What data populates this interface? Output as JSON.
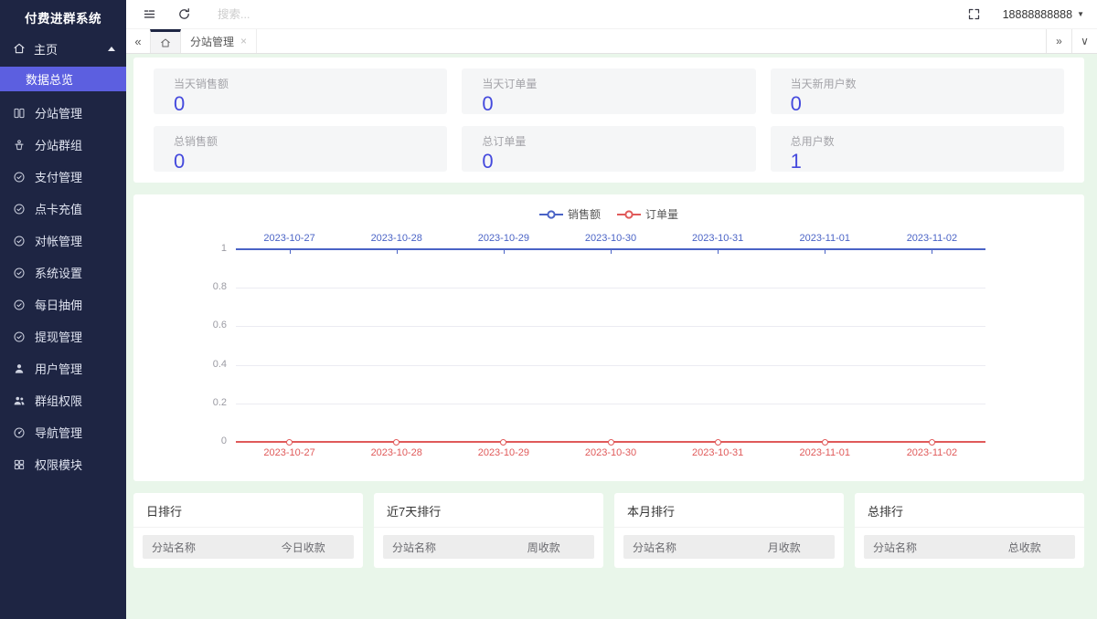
{
  "app": {
    "title": "付费进群系统"
  },
  "topbar": {
    "search_placeholder": "搜索...",
    "user_phone": "18888888888"
  },
  "glyphs": {
    "tabs_prev": "«",
    "tabs_next": "»",
    "tabs_menu": "∨",
    "tab_close": "×",
    "user_caret": "▼"
  },
  "tabbar": {
    "tabs": [
      {
        "label": "分站管理",
        "closable": true
      }
    ]
  },
  "sidebar": {
    "home": {
      "label": "主页"
    },
    "submenu_active": {
      "label": "数据总览"
    },
    "items": [
      {
        "label": "分站管理",
        "icon": "columns-icon"
      },
      {
        "label": "分站群组",
        "icon": "podium-icon"
      },
      {
        "label": "支付管理",
        "icon": "circle-check-icon"
      },
      {
        "label": "点卡充值",
        "icon": "circle-check-icon"
      },
      {
        "label": "对帐管理",
        "icon": "circle-check-icon"
      },
      {
        "label": "系统设置",
        "icon": "circle-check-icon"
      },
      {
        "label": "每日抽佣",
        "icon": "circle-check-icon"
      },
      {
        "label": "提现管理",
        "icon": "circle-check-icon"
      },
      {
        "label": "用户管理",
        "icon": "user-icon"
      },
      {
        "label": "群组权限",
        "icon": "users-icon"
      },
      {
        "label": "导航管理",
        "icon": "gauge-icon"
      },
      {
        "label": "权限模块",
        "icon": "grid-icon"
      }
    ]
  },
  "stats": {
    "items": [
      {
        "label": "当天销售额",
        "value": "0"
      },
      {
        "label": "当天订单量",
        "value": "0"
      },
      {
        "label": "当天新用户数",
        "value": "0"
      },
      {
        "label": "总销售额",
        "value": "0"
      },
      {
        "label": "总订单量",
        "value": "0"
      },
      {
        "label": "总用户数",
        "value": "1"
      }
    ]
  },
  "chart_data": {
    "type": "line",
    "title": "",
    "x": [
      "2023-10-27",
      "2023-10-28",
      "2023-10-29",
      "2023-10-30",
      "2023-10-31",
      "2023-11-01",
      "2023-11-02"
    ],
    "series": [
      {
        "name": "销售额",
        "color": "#4a63c6",
        "values": [
          0,
          0,
          0,
          0,
          0,
          0,
          0
        ],
        "x_axis": "top"
      },
      {
        "name": "订单量",
        "color": "#e05a5a",
        "values": [
          0,
          0,
          0,
          0,
          0,
          0,
          0
        ],
        "x_axis": "bottom"
      }
    ],
    "ylim": [
      0,
      1
    ],
    "y_ticks": [
      0,
      0.2,
      0.4,
      0.6,
      0.8,
      1
    ],
    "grid": "horizontal-lines",
    "legend_position": "top-center"
  },
  "rankings": [
    {
      "title": "日排行",
      "columns": [
        "分站名称",
        "今日收款"
      ],
      "rows": []
    },
    {
      "title": "近7天排行",
      "columns": [
        "分站名称",
        "周收款"
      ],
      "rows": []
    },
    {
      "title": "本月排行",
      "columns": [
        "分站名称",
        "月收款"
      ],
      "rows": []
    },
    {
      "title": "总排行",
      "columns": [
        "分站名称",
        "总收款"
      ],
      "rows": []
    }
  ],
  "colors": {
    "sidebar_bg": "#1e2543",
    "sidebar_active": "#5c5fe0",
    "stat_value": "#4449dd",
    "chart_blue": "#4a63c6",
    "chart_red": "#e05a5a",
    "content_bg": "#e9f6ea"
  }
}
